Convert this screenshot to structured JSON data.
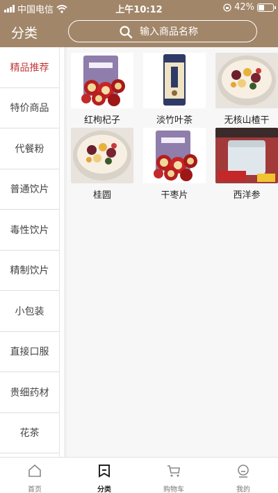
{
  "status_bar": {
    "carrier": "中国电信",
    "time": "上午10:12",
    "battery": "42%",
    "battery_level": 0.42
  },
  "header": {
    "title": "分类",
    "search_placeholder": "输入商品名称"
  },
  "sidebar": {
    "items": [
      {
        "label": "精品推荐",
        "active": true
      },
      {
        "label": "特价商品",
        "active": false
      },
      {
        "label": "代餐粉",
        "active": false
      },
      {
        "label": "普通饮片",
        "active": false
      },
      {
        "label": "毒性饮片",
        "active": false
      },
      {
        "label": "精制饮片",
        "active": false
      },
      {
        "label": "小包装",
        "active": false
      },
      {
        "label": "直接口服",
        "active": false
      },
      {
        "label": "贵细药材",
        "active": false
      },
      {
        "label": "花茶",
        "active": false
      }
    ]
  },
  "products": [
    {
      "label": "红枸杞子",
      "icon": "dried-fruit-bag-image"
    },
    {
      "label": "淡竹叶茶",
      "icon": "tea-can-image"
    },
    {
      "label": "无核山楂干",
      "icon": "fruit-bowl-image"
    },
    {
      "label": "桂圆",
      "icon": "fruit-bowl-image"
    },
    {
      "label": "干枣片",
      "icon": "dried-fruit-bag-image"
    },
    {
      "label": "西洋参",
      "icon": "ginseng-jar-image"
    }
  ],
  "tabbar": {
    "items": [
      {
        "label": "首页",
        "icon": "home-icon",
        "active": false
      },
      {
        "label": "分类",
        "icon": "category-icon",
        "active": true
      },
      {
        "label": "购物车",
        "icon": "cart-icon",
        "active": false
      },
      {
        "label": "我的",
        "icon": "profile-icon",
        "active": false
      }
    ]
  },
  "colors": {
    "header_bg": "#a2866a",
    "active_text": "#c33a3a"
  }
}
